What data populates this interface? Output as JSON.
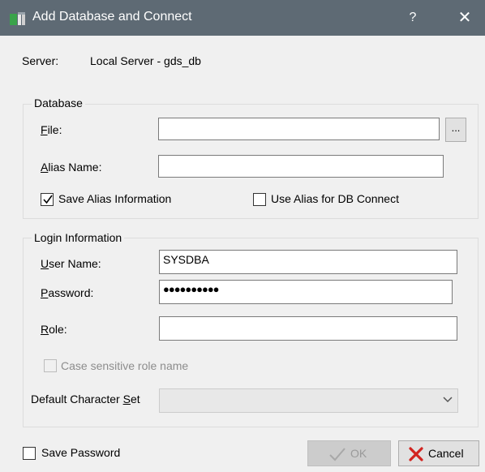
{
  "window": {
    "title": "Add Database and Connect",
    "help_symbol": "?",
    "close_symbol": "✕"
  },
  "server": {
    "label": "Server:",
    "value": "Local Server - gds_db"
  },
  "database_group": {
    "title": "Database",
    "file_label": "File:",
    "file_value": "",
    "browse_label": "...",
    "alias_label": "Alias Name:",
    "alias_value": "",
    "save_alias_label": "Save Alias Information",
    "save_alias_checked": true,
    "use_alias_label": "Use Alias for DB Connect",
    "use_alias_checked": false
  },
  "login_group": {
    "title": "Login Information",
    "username_label": "User Name:",
    "username_value": "SYSDBA",
    "password_label": "Password:",
    "password_value": "●●●●●●●●●●",
    "role_label": "Role:",
    "role_value": "",
    "case_sensitive_label": "Case sensitive role name",
    "case_sensitive_checked": false,
    "charset_label": "Default Character Set",
    "charset_value": ""
  },
  "footer": {
    "save_password_label": "Save Password",
    "save_password_checked": false,
    "ok_label": "OK",
    "cancel_label": "Cancel"
  },
  "icons": {
    "app": "database-icon",
    "check": "checkmark-icon",
    "ok": "checkmark-icon",
    "cancel": "red-x-icon",
    "dropdown": "chevron-down-icon"
  },
  "colors": {
    "titlebar": "#5e6a74",
    "dialog_bg": "#f0f0f0",
    "cancel_icon": "#d2231f"
  }
}
